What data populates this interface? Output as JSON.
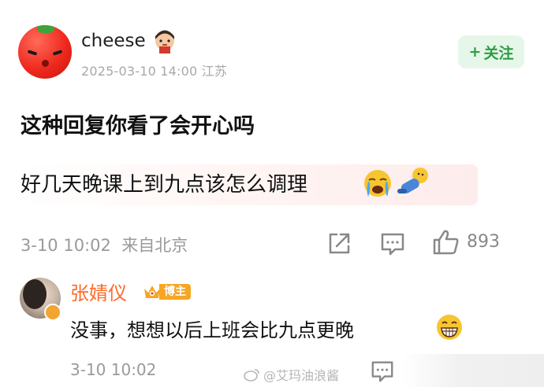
{
  "post": {
    "username": "cheese",
    "timestamp": "2025-03-10 14:00 江苏",
    "follow_label": "关注",
    "title": "这种回复你看了会开心吗",
    "quote": "好几天晚课上到九点该怎么调理",
    "meta": "3-10 10:02  来自北京",
    "like_count": "893"
  },
  "reply": {
    "username": "张婧仪",
    "badge": "博主",
    "text": "没事，想想以后上班会比九点更晚",
    "meta": "3-10 10:02",
    "watermark": "@艾玛油浪酱"
  },
  "icons": [
    "plus-icon",
    "share-icon",
    "comment-icon",
    "like-icon",
    "cry-emoji-icon",
    "fall-emoji-icon",
    "grin-emoji-icon",
    "crown-icon",
    "weibo-logo-icon"
  ],
  "colors": {
    "follow_bg": "#e6f7ea",
    "follow_fg": "#2d9e42",
    "reply_name": "#ff6a2a",
    "badge": "#f6a623",
    "meta_text": "#9a9a9a"
  }
}
